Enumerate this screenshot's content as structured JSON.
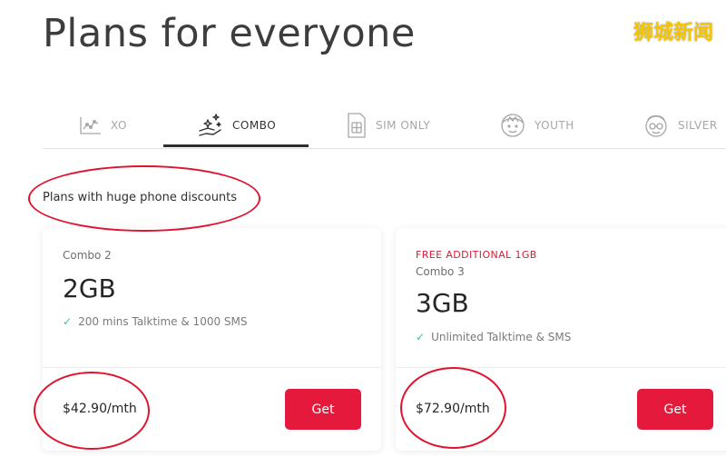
{
  "page": {
    "title": "Plans for everyone",
    "watermark": "狮城新闻"
  },
  "tabs": [
    {
      "label": "XO",
      "icon": "xo-icon",
      "active": false
    },
    {
      "label": "COMBO",
      "icon": "combo-icon",
      "active": true
    },
    {
      "label": "SIM ONLY",
      "icon": "sim-card-icon",
      "active": false
    },
    {
      "label": "YOUTH",
      "icon": "youth-face-icon",
      "active": false
    },
    {
      "label": "SILVER",
      "icon": "senior-face-icon",
      "active": false
    }
  ],
  "section": {
    "subtitle": "Plans with huge phone discounts"
  },
  "plans": [
    {
      "promo": "",
      "name": "Combo 2",
      "data": "2GB",
      "feature": "200 mins Talktime & 1000 SMS",
      "price": "$42.90/mth",
      "cta": "Get"
    },
    {
      "promo": "FREE ADDITIONAL 1GB",
      "name": "Combo 3",
      "data": "3GB",
      "feature": "Unlimited Talktime & SMS",
      "price": "$72.90/mth",
      "cta": "Get"
    }
  ],
  "colors": {
    "accent_red": "#e4193c",
    "promo_red": "#d2203a",
    "check_teal": "#3bbfae",
    "annotation_red": "#e0142e",
    "watermark_yellow": "#f5c400"
  },
  "check_glyph": "✓"
}
